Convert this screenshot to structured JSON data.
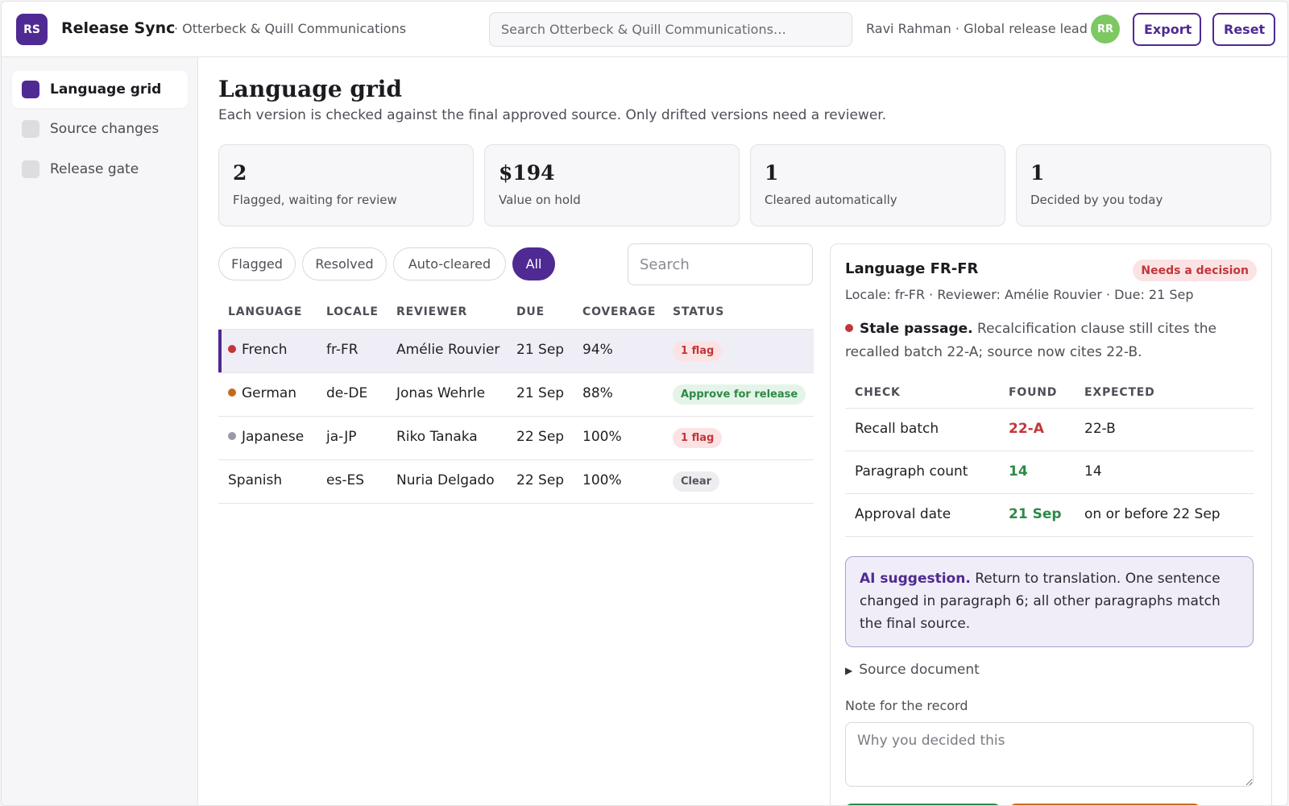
{
  "header": {
    "logo_initials": "RS",
    "app_title": "Release Sync",
    "org_name": "· Otterbeck & Quill Communications",
    "search_placeholder": "Search Otterbeck & Quill Communications…",
    "user_label": "Ravi Rahman · Global release lead",
    "avatar_initials": "RR",
    "export_label": "Export",
    "reset_label": "Reset"
  },
  "sidebar": {
    "items": [
      {
        "label": "Language grid",
        "active": true
      },
      {
        "label": "Source changes",
        "active": false
      },
      {
        "label": "Release gate",
        "active": false
      }
    ]
  },
  "main": {
    "title": "Language grid",
    "subtitle": "Each version is checked against the final approved source. Only drifted versions need a reviewer.",
    "stats": [
      {
        "value": "2",
        "label": "Flagged, waiting for review"
      },
      {
        "value": "$194",
        "label": "Value on hold"
      },
      {
        "value": "1",
        "label": "Cleared automatically"
      },
      {
        "value": "1",
        "label": "Decided by you today"
      }
    ],
    "filters": [
      {
        "label": "Flagged",
        "active": false
      },
      {
        "label": "Resolved",
        "active": false
      },
      {
        "label": "Auto-cleared",
        "active": false
      },
      {
        "label": "All",
        "active": true
      }
    ],
    "search_placeholder": "Search",
    "table": {
      "columns": [
        "LANGUAGE",
        "LOCALE",
        "REVIEWER",
        "DUE",
        "COVERAGE",
        "STATUS"
      ],
      "rows": [
        {
          "language": "French",
          "locale": "fr-FR",
          "reviewer": "Amélie Rouvier",
          "due": "21 Sep",
          "coverage": "94%",
          "status": "1 flag",
          "status_type": "flag",
          "dot_color": "#c2363a",
          "selected": true
        },
        {
          "language": "German",
          "locale": "de-DE",
          "reviewer": "Jonas Wehrle",
          "due": "21 Sep",
          "coverage": "88%",
          "status": "Approve for release",
          "status_type": "approve",
          "dot_color": "#c56a1e",
          "selected": false
        },
        {
          "language": "Japanese",
          "locale": "ja-JP",
          "reviewer": "Riko Tanaka",
          "due": "22 Sep",
          "coverage": "100%",
          "status": "1 flag",
          "status_type": "flag",
          "dot_color": "#9a9aa6",
          "selected": false
        },
        {
          "language": "Spanish",
          "locale": "es-ES",
          "reviewer": "Nuria Delgado",
          "due": "22 Sep",
          "coverage": "100%",
          "status": "Clear",
          "status_type": "clear",
          "dot_color": "",
          "selected": false
        }
      ]
    }
  },
  "detail": {
    "title": "Language FR-FR",
    "badge": "Needs a decision",
    "meta": "Locale: fr-FR · Reviewer: Amélie Rouvier · Due: 21 Sep",
    "warning_title": "Stale passage.",
    "warning_text": "Recalcification clause still cites the recalled batch 22-A; source now cites 22-B.",
    "checks": {
      "columns": [
        "CHECK",
        "FOUND",
        "EXPECTED"
      ],
      "rows": [
        {
          "check": "Recall batch",
          "found": "22-A",
          "expected": "22-B",
          "ok": false
        },
        {
          "check": "Paragraph count",
          "found": "14",
          "expected": "14",
          "ok": true
        },
        {
          "check": "Approval date",
          "found": "21 Sep",
          "expected": "on or before 22 Sep",
          "ok": true
        }
      ]
    },
    "ai_title": "AI suggestion.",
    "ai_text": "Return to translation. One sentence changed in paragraph 6; all other paragraphs match the final source.",
    "source_toggle": "Source document",
    "note_label": "Note for the record",
    "note_placeholder": "Why you decided this"
  },
  "colors": {
    "accent": "#4f2a93",
    "flag": "#c2363a",
    "ok": "#2d8a46",
    "warn": "#c56a1e"
  }
}
